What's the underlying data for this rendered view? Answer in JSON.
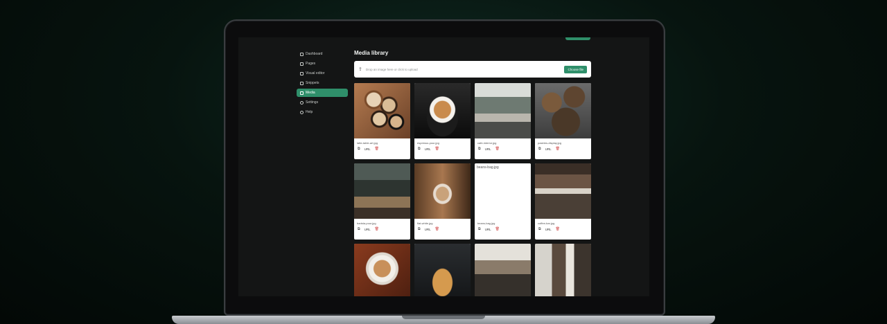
{
  "sidebar": {
    "items": [
      {
        "label": "Dashboard",
        "icon": "grid-icon",
        "active": false
      },
      {
        "label": "Pages",
        "icon": "page-icon",
        "active": false
      },
      {
        "label": "Visual editor",
        "icon": "pen-icon",
        "active": false
      },
      {
        "label": "Snippets",
        "icon": "snippet-icon",
        "active": false
      },
      {
        "label": "Media",
        "icon": "image-icon",
        "active": true
      },
      {
        "label": "Settings",
        "icon": "gear-icon",
        "active": false
      },
      {
        "label": "Help",
        "icon": "help-icon",
        "active": false
      }
    ]
  },
  "main": {
    "title": "Media library",
    "upload": {
      "text": "Drop an image here or click to upload",
      "button": "Choose file"
    },
    "cards": [
      {
        "name": "latte-table-art.jpg",
        "thumb": "t-latte"
      },
      {
        "name": "espresso-pour.jpg",
        "thumb": "t-espresso"
      },
      {
        "name": "cafe-interior.jpg",
        "thumb": "t-interior"
      },
      {
        "name": "pastries-display.jpg",
        "thumb": "t-bread"
      },
      {
        "name": "barista-pour.jpg",
        "thumb": "t-barista"
      },
      {
        "name": "flat-white.jpg",
        "thumb": "t-flatwhite"
      },
      {
        "name": "beans-bag.jpg",
        "thumb": "broken",
        "broken_label": "beans-bag.jpg"
      },
      {
        "name": "coffee-bar.jpg",
        "thumb": "t-coffeebar"
      },
      {
        "name": "",
        "thumb": "t-cup"
      },
      {
        "name": "",
        "thumb": "t-croissant"
      },
      {
        "name": "",
        "thumb": "t-shop"
      },
      {
        "name": "",
        "thumb": "t-people"
      }
    ],
    "url_label": "URL"
  },
  "colors": {
    "accent": "#2f8f6a",
    "delete": "#d04848"
  }
}
